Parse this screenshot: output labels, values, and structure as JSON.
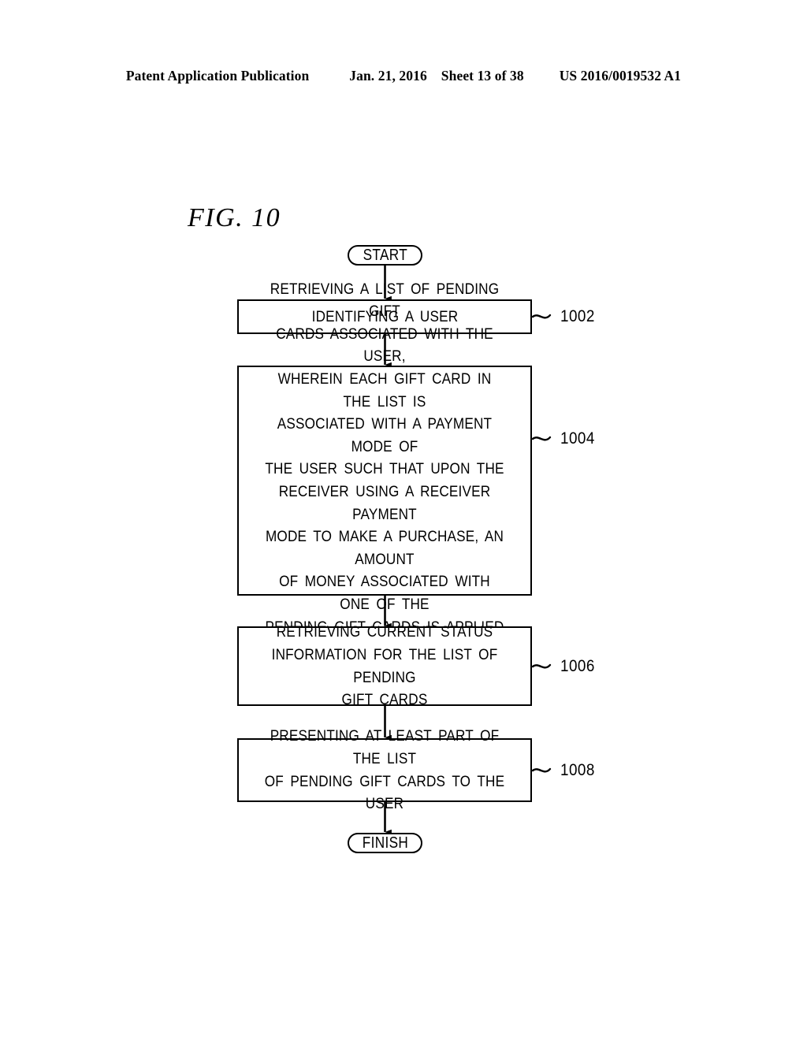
{
  "header": {
    "publication": "Patent Application Publication",
    "date": "Jan. 21, 2016",
    "sheet": "Sheet 13 of 38",
    "pub_number": "US 2016/0019532 A1"
  },
  "figure": {
    "label": "FIG. 10",
    "type": "flowchart"
  },
  "flowchart": {
    "start_label": "START",
    "finish_label": "FINISH",
    "steps": [
      {
        "ref": "1002",
        "text": "IDENTIFYING A USER"
      },
      {
        "ref": "1004",
        "text": "RETRIEVING A LIST OF PENDING GIFT\nCARDS ASSOCIATED WITH THE USER,\nWHEREIN EACH GIFT CARD IN THE LIST IS\nASSOCIATED WITH A PAYMENT MODE OF\nTHE USER SUCH THAT UPON THE\nRECEIVER USING A RECEIVER PAYMENT\nMODE TO MAKE A PURCHASE, AN AMOUNT\nOF MONEY ASSOCIATED WITH ONE OF THE\nPENDING GIFT CARDS IS APPLIED TO THE\nPURCHASE"
      },
      {
        "ref": "1006",
        "text": "RETRIEVING CURRENT STATUS\nINFORMATION FOR THE LIST OF PENDING\nGIFT CARDS"
      },
      {
        "ref": "1008",
        "text": "PRESENTING AT LEAST PART OF THE LIST\nOF PENDING GIFT CARDS TO THE USER"
      }
    ]
  },
  "colors": {
    "ink": "#000000",
    "paper": "#ffffff"
  }
}
